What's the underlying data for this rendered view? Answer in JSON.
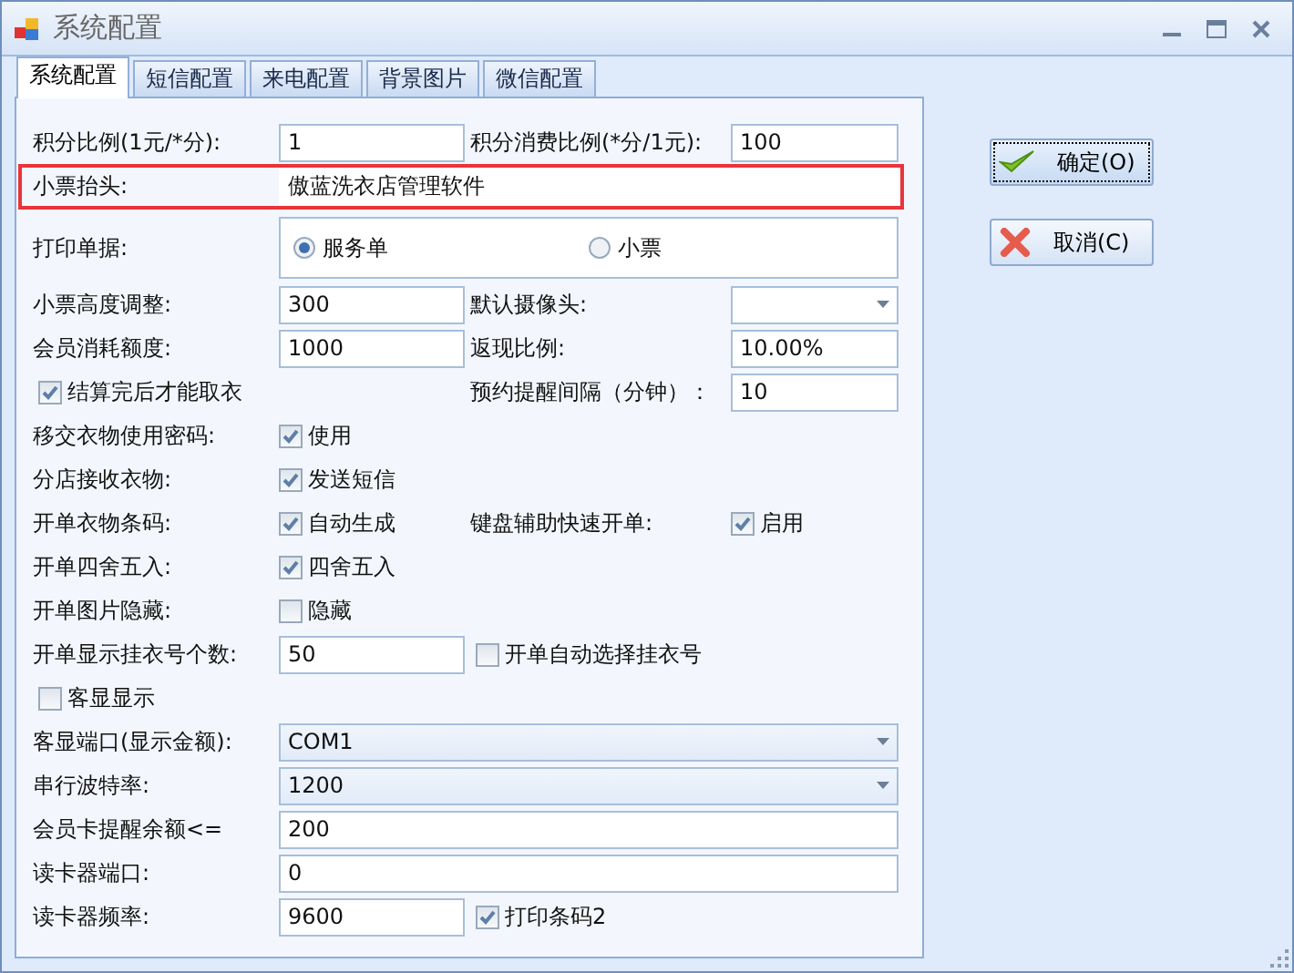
{
  "window": {
    "title": "系统配置"
  },
  "tabs": [
    {
      "label": "系统配置",
      "selected": true
    },
    {
      "label": "短信配置",
      "selected": false
    },
    {
      "label": "来电配置",
      "selected": false
    },
    {
      "label": "背景图片",
      "selected": false
    },
    {
      "label": "微信配置",
      "selected": false
    }
  ],
  "form": {
    "rows": [
      {
        "kind": "pair",
        "highlighted": false,
        "items": [
          {
            "kind": "label",
            "text": "积分比例(1元/*分):"
          },
          {
            "kind": "text",
            "value": "1"
          },
          {
            "kind": "label",
            "text": "积分消费比例(*分/1元):"
          },
          {
            "kind": "text",
            "value": "100"
          }
        ]
      },
      {
        "kind": "wide",
        "highlighted": true,
        "items": [
          {
            "kind": "label",
            "text": "小票抬头:"
          },
          {
            "kind": "text",
            "value": "傲蓝洗衣店管理软件"
          }
        ]
      },
      {
        "kind": "radio",
        "highlighted": false,
        "items": [
          {
            "kind": "label",
            "text": "打印单据:"
          },
          {
            "kind": "options",
            "options": [
              {
                "label": "服务单",
                "selected": true
              },
              {
                "label": "小票",
                "selected": false
              }
            ]
          }
        ]
      },
      {
        "kind": "pair",
        "highlighted": false,
        "items": [
          {
            "kind": "label",
            "text": "小票高度调整:"
          },
          {
            "kind": "text",
            "value": "300"
          },
          {
            "kind": "label",
            "text": "默认摄像头:"
          },
          {
            "kind": "select"
          }
        ]
      },
      {
        "kind": "pair",
        "highlighted": false,
        "items": [
          {
            "kind": "label",
            "text": "会员消耗额度:"
          },
          {
            "kind": "text",
            "value": "1000"
          },
          {
            "kind": "label",
            "text": "返现比例:"
          },
          {
            "kind": "text",
            "value": "10.00%"
          }
        ]
      },
      {
        "kind": "check",
        "highlighted": false,
        "items": [
          {
            "kind": "checkbox",
            "label": "结算完后才能取衣",
            "checked": true
          },
          {
            "kind": "label",
            "text": "预约提醒间隔（分钟）："
          },
          {
            "kind": "text",
            "value": "10"
          }
        ]
      },
      {
        "kind": "pair",
        "highlighted": false,
        "items": [
          {
            "kind": "label",
            "text": "移交衣物使用密码:"
          },
          {
            "kind": "checkbox",
            "label": "使用",
            "checked": true
          }
        ]
      },
      {
        "kind": "pair",
        "highlighted": false,
        "items": [
          {
            "kind": "label",
            "text": "分店接收衣物:"
          },
          {
            "kind": "checkbox",
            "label": "发送短信",
            "checked": true
          }
        ]
      },
      {
        "kind": "pair",
        "highlighted": false,
        "items": [
          {
            "kind": "label",
            "text": "开单衣物条码:"
          },
          {
            "kind": "checkbox",
            "label": "自动生成",
            "checked": true
          },
          {
            "kind": "label",
            "text": "键盘辅助快速开单:"
          },
          {
            "kind": "checkbox",
            "label": "启用",
            "checked": true
          }
        ]
      },
      {
        "kind": "pair",
        "highlighted": false,
        "items": [
          {
            "kind": "label",
            "text": "开单四舍五入:"
          },
          {
            "kind": "checkbox",
            "label": "四舍五入",
            "checked": true
          }
        ]
      },
      {
        "kind": "pair",
        "highlighted": false,
        "items": [
          {
            "kind": "label",
            "text": "开单图片隐藏:"
          },
          {
            "kind": "checkbox",
            "label": "隐藏",
            "checked": false
          }
        ]
      },
      {
        "kind": "pair",
        "highlighted": false,
        "items": [
          {
            "kind": "label",
            "text": "开单显示挂衣号个数:"
          },
          {
            "kind": "text",
            "value": "50"
          },
          {
            "kind": "checkbox",
            "label": "开单自动选择挂衣号",
            "checked": false
          }
        ]
      },
      {
        "kind": "check",
        "highlighted": false,
        "items": [
          {
            "kind": "checkbox",
            "label": "客显显示",
            "checked": false
          }
        ]
      },
      {
        "kind": "wide",
        "highlighted": false,
        "items": [
          {
            "kind": "label",
            "text": "客显端口(显示金额):"
          },
          {
            "kind": "select",
            "value": "COM1"
          }
        ]
      },
      {
        "kind": "wide",
        "highlighted": false,
        "items": [
          {
            "kind": "label",
            "text": "串行波特率:"
          },
          {
            "kind": "select",
            "value": "1200"
          }
        ]
      },
      {
        "kind": "wide",
        "highlighted": false,
        "items": [
          {
            "kind": "label",
            "text": "会员卡提醒余额<="
          },
          {
            "kind": "text",
            "value": "200"
          }
        ]
      },
      {
        "kind": "wide",
        "highlighted": false,
        "items": [
          {
            "kind": "label",
            "text": "读卡器端口:"
          },
          {
            "kind": "text",
            "value": "0"
          }
        ]
      },
      {
        "kind": "pair",
        "highlighted": false,
        "items": [
          {
            "kind": "label",
            "text": "读卡器频率:"
          },
          {
            "kind": "text",
            "value": "9600"
          },
          {
            "kind": "checkbox",
            "label": "打印条码2",
            "checked": true
          }
        ]
      }
    ]
  },
  "buttons": [
    {
      "kind": "ok",
      "label": "确定(O)",
      "focused": true
    },
    {
      "kind": "cancel",
      "label": "取消(C)",
      "focused": false
    }
  ]
}
